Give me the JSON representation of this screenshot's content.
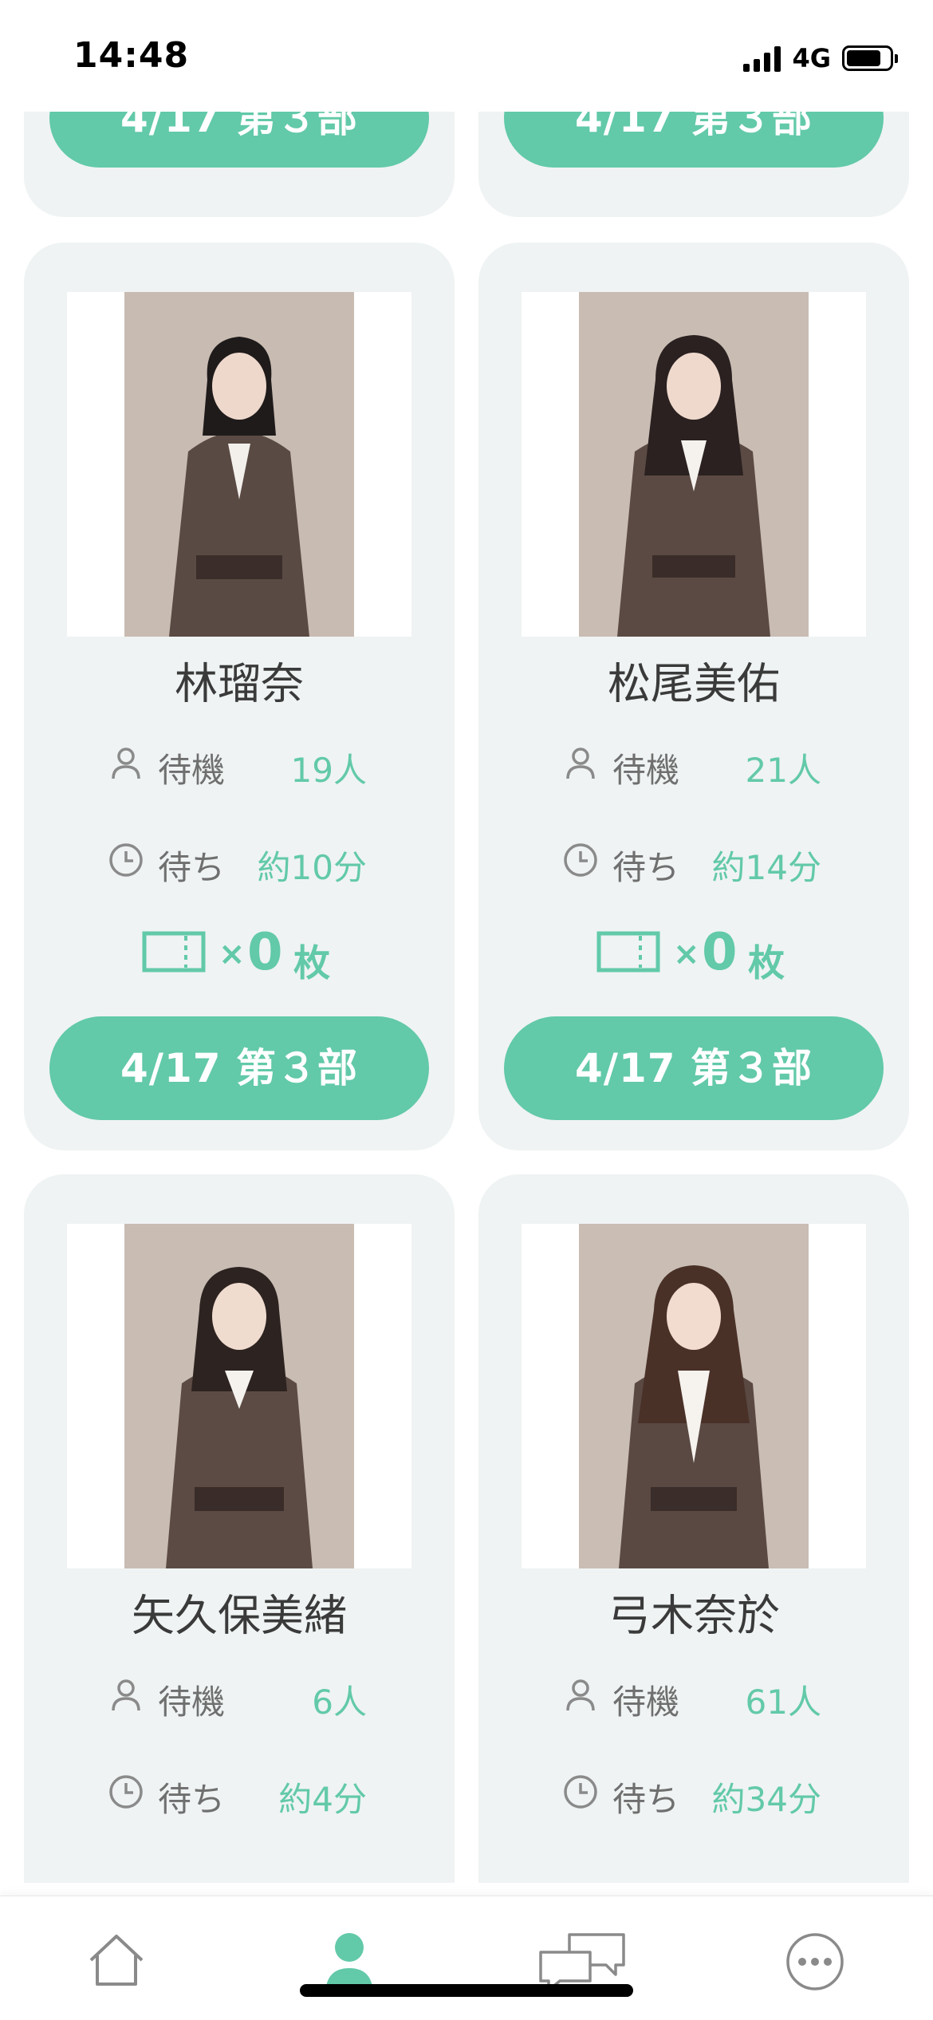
{
  "status_bar": {
    "time": "14:48",
    "network": "4G",
    "battery_level": 0.8
  },
  "labels": {
    "waiting": "待機",
    "wait_time": "待ち"
  },
  "top_cards": [
    {
      "button": "4/17 第３部"
    },
    {
      "button": "4/17 第３部"
    }
  ],
  "members": [
    {
      "name": "林瑠奈",
      "waiting_count": "19人",
      "wait_time": "約10分",
      "ticket_prefix": "×",
      "ticket_count": "0",
      "ticket_unit": "枚",
      "button": "4/17 第３部"
    },
    {
      "name": "松尾美佑",
      "waiting_count": "21人",
      "wait_time": "約14分",
      "ticket_prefix": "×",
      "ticket_count": "0",
      "ticket_unit": "枚",
      "button": "4/17 第３部"
    },
    {
      "name": "矢久保美緒",
      "waiting_count": "6人",
      "wait_time": "約4分"
    },
    {
      "name": "弓木奈於",
      "waiting_count": "61人",
      "wait_time": "約34分"
    }
  ],
  "colors": {
    "accent": "#62c9a9",
    "card_bg": "#eff3f3",
    "icon_gray": "#8a8a8a"
  },
  "tab_bar": [
    {
      "icon": "home-icon",
      "active": false
    },
    {
      "icon": "person-icon",
      "active": true
    },
    {
      "icon": "chat-icon",
      "active": false
    },
    {
      "icon": "more-icon",
      "active": false
    }
  ]
}
